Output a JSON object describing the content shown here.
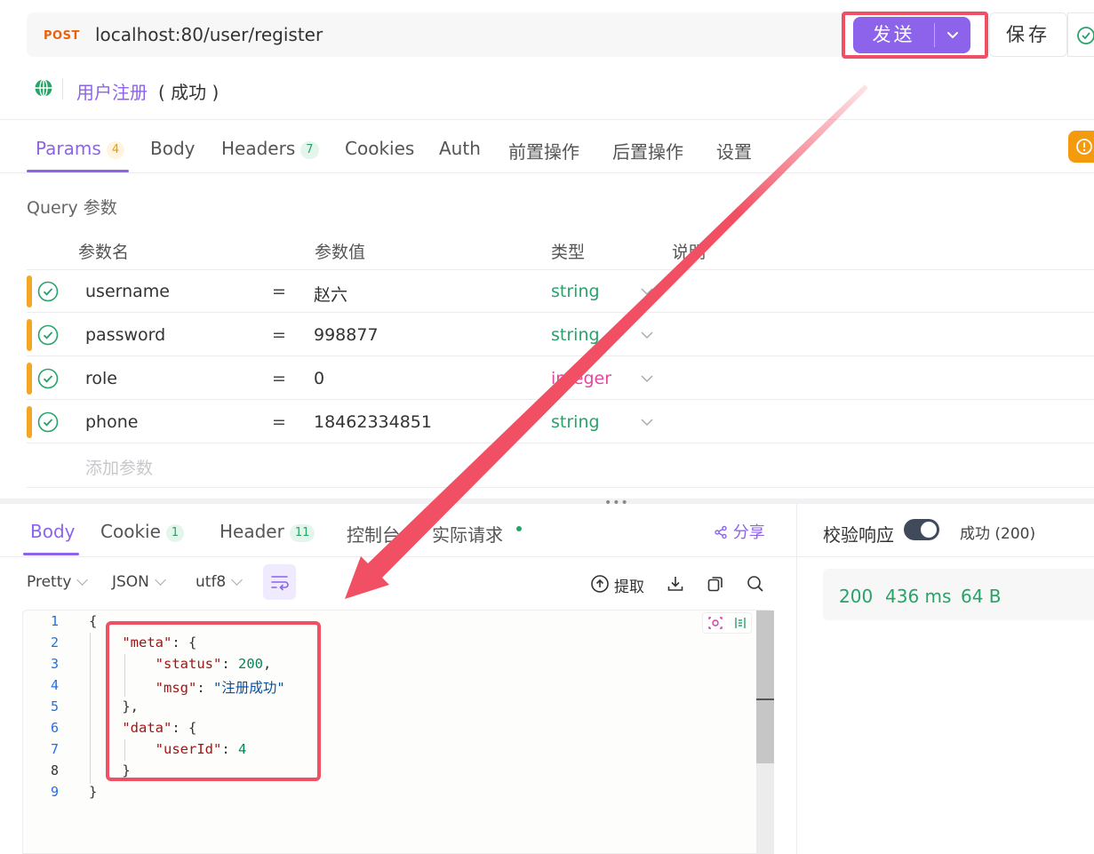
{
  "request": {
    "method": "POST",
    "url": "localhost:80/user/register",
    "send_label": "发送",
    "save_label": "保存",
    "api_name": "用户注册",
    "api_status": "( 成功 )"
  },
  "request_tabs": [
    {
      "label": "Params",
      "badge": "4"
    },
    {
      "label": "Body"
    },
    {
      "label": "Headers",
      "badge": "7"
    },
    {
      "label": "Cookies"
    },
    {
      "label": "Auth"
    },
    {
      "label": "前置操作"
    },
    {
      "label": "后置操作"
    },
    {
      "label": "设置"
    }
  ],
  "query": {
    "title": "Query 参数",
    "headers": [
      "参数名",
      "参数值",
      "类型",
      "说明"
    ],
    "rows": [
      {
        "name": "username",
        "eq": "=",
        "value": "赵六",
        "type": "string"
      },
      {
        "name": "password",
        "eq": "=",
        "value": "998877",
        "type": "string"
      },
      {
        "name": "role",
        "eq": "=",
        "value": "0",
        "type": "integer"
      },
      {
        "name": "phone",
        "eq": "=",
        "value": "18462334851",
        "type": "string"
      }
    ],
    "add_placeholder": "添加参数"
  },
  "response_tabs": [
    {
      "label": "Body"
    },
    {
      "label": "Cookie",
      "badge": "1"
    },
    {
      "label": "Header",
      "badge": "11"
    },
    {
      "label": "控制台"
    },
    {
      "label": "实际请求"
    }
  ],
  "share_label": "分享",
  "format": {
    "view": "Pretty",
    "lang": "JSON",
    "encoding": "utf8",
    "extract_label": "提取"
  },
  "code_lines": [
    "{",
    "    \"meta\": {",
    "        \"status\": 200,",
    "        \"msg\": \"注册成功\"",
    "    },",
    "    \"data\": {",
    "        \"userId\": 4",
    "    }",
    "}"
  ],
  "verify": {
    "label": "校验响应",
    "enabled": true,
    "result": "成功 (200)"
  },
  "response_status": {
    "code": "200",
    "time": "436 ms",
    "size": "64 B"
  },
  "colors": {
    "accent": "#8c63ea",
    "success": "#27a36a",
    "method": "#e8620e",
    "highlight": "#f14f63",
    "warning": "#f5a623"
  }
}
